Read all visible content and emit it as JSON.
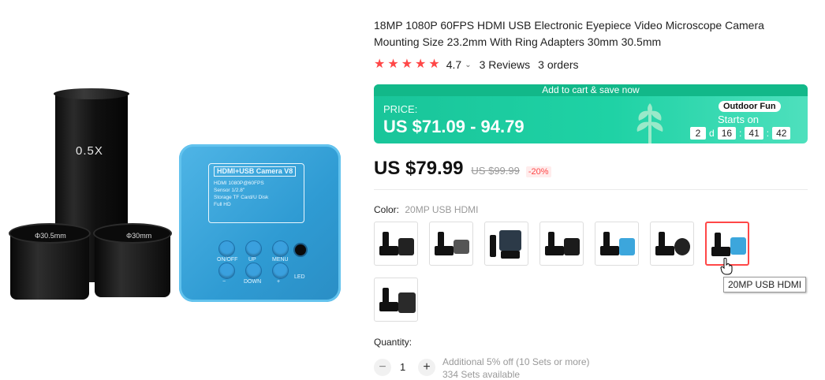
{
  "product": {
    "title": "18MP 1080P 60FPS HDMI USB Electronic Eyepiece Video Microscope Camera Mounting Size 23.2mm With Ring Adapters 30mm 30.5mm",
    "image": {
      "tube_label": "0.5X",
      "ring_left_label": "Φ30.5mm",
      "ring_right_label": "Φ30mm",
      "camera_title": "HDMI+USB Camera V8",
      "camera_specs": [
        "HDMI 1080P@60FPS",
        "Sensor 1/2.8\"",
        "Storage TF Card/U Disk",
        "Full HD"
      ],
      "buttons": [
        {
          "icon": "power-icon",
          "label": "ON/OFF"
        },
        {
          "icon": "zoom-in-icon",
          "label": "UP"
        },
        {
          "icon": "menu-icon",
          "label": "MENU"
        },
        {
          "icon": "record-icon",
          "label": "−"
        },
        {
          "icon": "zoom-out-icon",
          "label": "DOWN"
        },
        {
          "icon": "camera-icon",
          "label": "+"
        }
      ],
      "led_label": "LED"
    }
  },
  "rating": {
    "stars": 5,
    "value": "4.7",
    "reviews": "3 Reviews",
    "orders": "3 orders",
    "star_color": "#ff4747"
  },
  "banner": {
    "top_text": "Add to cart & save now",
    "price_label": "PRICE:",
    "price_range": "US $71.09 - 94.79",
    "promo_badge": "Outdoor Fun",
    "starts_on": "Starts on",
    "countdown": {
      "days": "2",
      "day_unit": "d",
      "hours": "16",
      "minutes": "41",
      "seconds": "42",
      "sep": ":"
    },
    "bg_color": "#1fd2a5"
  },
  "price": {
    "current": "US $79.99",
    "original": "US $99.99",
    "discount": "-20%"
  },
  "color": {
    "label": "Color:",
    "selected": "20MP USB HDMI",
    "swatch_count": 8,
    "selected_index": 6,
    "tooltip": "20MP USB HDMI"
  },
  "quantity": {
    "label": "Quantity:",
    "value": "1",
    "minus": "−",
    "plus": "+",
    "note": "Additional 5% off (10 Sets or more)",
    "note2": "334 Sets available"
  }
}
